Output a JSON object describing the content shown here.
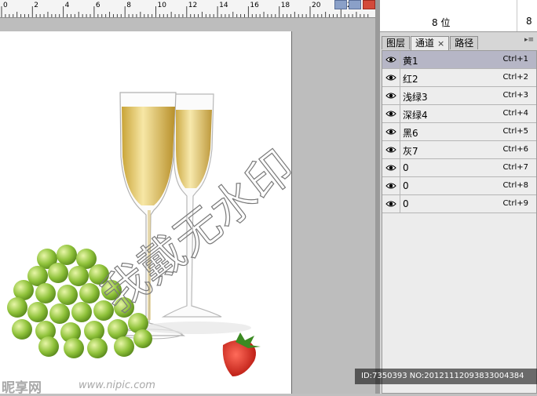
{
  "ruler": {
    "ticks": [
      "0",
      "2",
      "4",
      "6",
      "8",
      "10",
      "12",
      "14",
      "16",
      "18",
      "20",
      "22"
    ]
  },
  "info": {
    "bit_depth": "8 位",
    "bit_depth_right": "8"
  },
  "tabs": [
    {
      "label": "图层",
      "active": false
    },
    {
      "label": "通道",
      "active": true,
      "close": "×"
    },
    {
      "label": "路径",
      "active": false
    }
  ],
  "panel_menu": "▸≡",
  "channels": [
    {
      "name": "黄1",
      "shortcut": "Ctrl+1",
      "active": true
    },
    {
      "name": "红2",
      "shortcut": "Ctrl+2",
      "active": false
    },
    {
      "name": "浅绿3",
      "shortcut": "Ctrl+3",
      "active": false
    },
    {
      "name": "深绿4",
      "shortcut": "Ctrl+4",
      "active": false
    },
    {
      "name": "黑6",
      "shortcut": "Ctrl+5",
      "active": false
    },
    {
      "name": "灰7",
      "shortcut": "Ctrl+6",
      "active": false
    },
    {
      "name": "0",
      "shortcut": "Ctrl+7",
      "active": false
    },
    {
      "name": "0",
      "shortcut": "Ctrl+8",
      "active": false
    },
    {
      "name": "0",
      "shortcut": "Ctrl+9",
      "active": false
    }
  ],
  "watermark": {
    "id_text": "ID:7350393 NO:20121112093833004384",
    "logo": "昵享网",
    "url": "www.nipic.com",
    "overlay_text": "我戴无水印"
  }
}
